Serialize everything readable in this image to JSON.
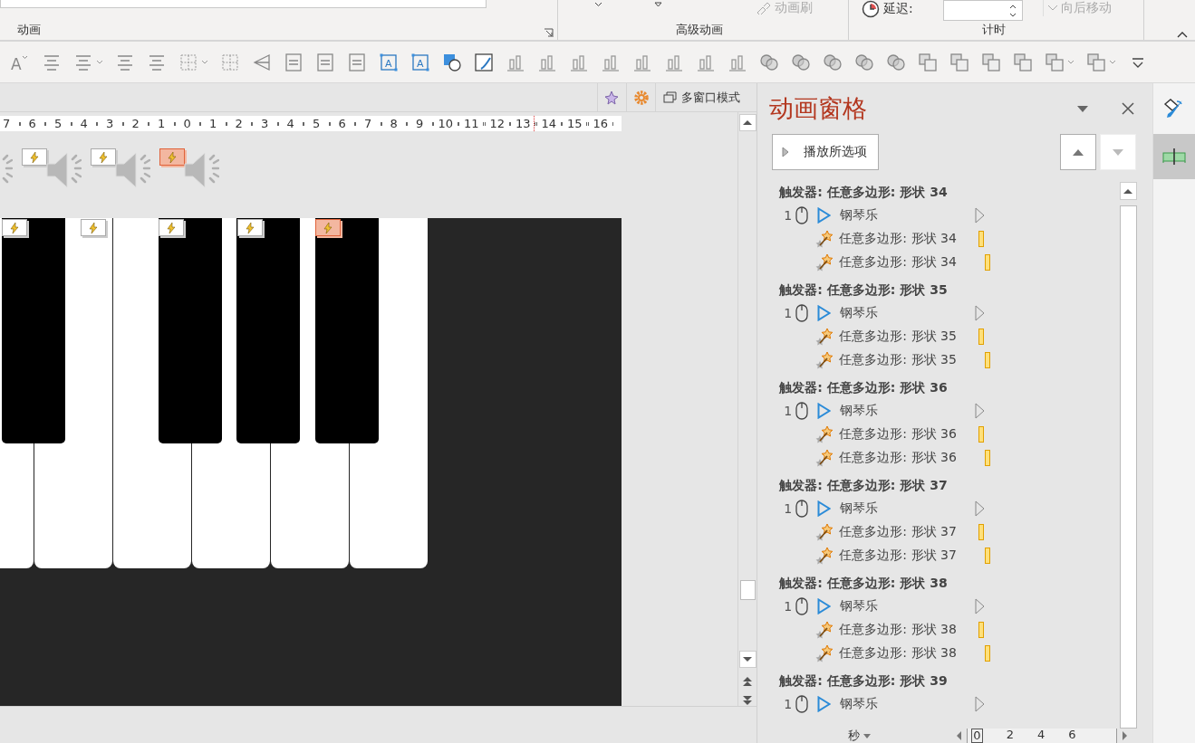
{
  "ribbon": {
    "animation_group_label": "动画",
    "painter_button": {
      "label": "动画刷",
      "disabled": true
    },
    "advanced_group_label": "高级动画",
    "delay_label": "延迟:",
    "move_later_button": {
      "label": "向后移动",
      "disabled": true
    },
    "timing_group_label": "计时"
  },
  "toolbar": {
    "font_size_letter": "A",
    "text_box_letters": [
      "A",
      "A"
    ]
  },
  "editor": {
    "multiwindow_button": "多窗口模式",
    "ruler_labels": [
      "7",
      "6",
      "5",
      "4",
      "3",
      "2",
      "1",
      "0",
      "1",
      "2",
      "3",
      "4",
      "5",
      "6",
      "7",
      "8",
      "9",
      "10",
      "11",
      "12",
      "13",
      "14",
      "15",
      "16"
    ],
    "sound_tags": [
      {
        "selected": false
      },
      {
        "selected": false
      },
      {
        "selected": true
      }
    ],
    "key_tags": [
      {
        "selected": false
      },
      {
        "selected": false
      },
      {
        "selected": false
      },
      {
        "selected": false
      },
      {
        "selected": true
      }
    ]
  },
  "animation_pane": {
    "title": "动画窗格",
    "play_button": "播放所选项",
    "move_up": {
      "disabled": false
    },
    "move_down": {
      "disabled": true
    },
    "groups": [
      {
        "trigger": "触发器: 任意多边形: 形状 34",
        "effect": {
          "order": "1",
          "name": "钢琴乐"
        },
        "sub_effects": [
          {
            "name": "任意多边形: 形状 34"
          },
          {
            "name": "任意多边形: 形状 34"
          }
        ]
      },
      {
        "trigger": "触发器: 任意多边形: 形状 35",
        "effect": {
          "order": "1",
          "name": "钢琴乐"
        },
        "sub_effects": [
          {
            "name": "任意多边形: 形状 35"
          },
          {
            "name": "任意多边形: 形状 35"
          }
        ]
      },
      {
        "trigger": "触发器: 任意多边形: 形状 36",
        "effect": {
          "order": "1",
          "name": "钢琴乐"
        },
        "sub_effects": [
          {
            "name": "任意多边形: 形状 36"
          },
          {
            "name": "任意多边形: 形状 36"
          }
        ]
      },
      {
        "trigger": "触发器: 任意多边形: 形状 37",
        "effect": {
          "order": "1",
          "name": "钢琴乐"
        },
        "sub_effects": [
          {
            "name": "任意多边形: 形状 37"
          },
          {
            "name": "任意多边形: 形状 37"
          }
        ]
      },
      {
        "trigger": "触发器: 任意多边形: 形状 38",
        "effect": {
          "order": "1",
          "name": "钢琴乐"
        },
        "sub_effects": [
          {
            "name": "任意多边形: 形状 38"
          },
          {
            "name": "任意多边形: 形状 38"
          }
        ]
      },
      {
        "trigger": "触发器: 任意多边形: 形状 39",
        "effect": {
          "order": "1",
          "name": "钢琴乐"
        }
      }
    ],
    "timeline": {
      "unit": "秒",
      "ticks": [
        "0",
        "2",
        "4",
        "6"
      ]
    }
  },
  "side_strip": [
    {
      "selected": false
    },
    {
      "selected": true
    }
  ]
}
